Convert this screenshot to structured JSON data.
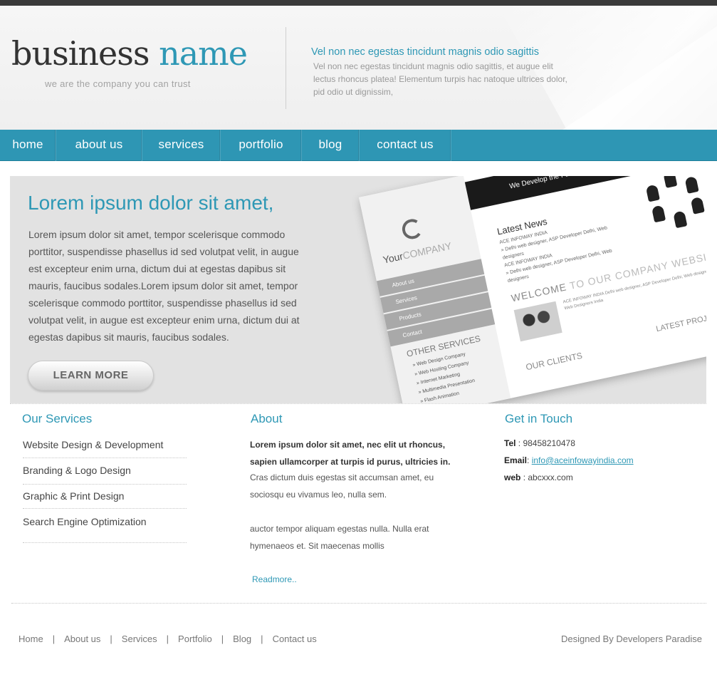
{
  "header": {
    "logo_word1": "business",
    "logo_word2": "name",
    "tagline": "we are the company you can trust",
    "intro_title": "Vel non nec egestas tincidunt magnis odio sagittis",
    "intro_text": "Vel non nec egestas tincidunt magnis odio sagittis, et augue elit lectus rhoncus platea! Elementum turpis hac natoque ultrices dolor, pid odio ut dignissim,"
  },
  "nav": {
    "items": [
      "home",
      "about us",
      "services",
      "portfolio",
      "blog",
      "contact us"
    ]
  },
  "hero": {
    "title": "Lorem ipsum dolor sit amet,",
    "text": "Lorem ipsum dolor sit amet, tempor scelerisque commodo porttitor, suspendisse phasellus id sed volutpat velit, in augue est excepteur enim urna, dictum dui at egestas dapibus sit mauris, faucibus sodales.Lorem ipsum dolor sit amet, tempor scelerisque commodo porttitor, suspendisse phasellus id sed volutpat velit, in augue est excepteur enim urna, dictum dui at egestas dapibus sit mauris, faucibus sodales.",
    "button_label": "LEARN MORE",
    "mockup": {
      "bar_text": "We Develop the Future ACE INFOWAY INDIA",
      "company_a": "Your",
      "company_b": "COMPANY",
      "menu": [
        "About us",
        "Services",
        "Products",
        "Contact"
      ],
      "other_services": "OTHER SERVICES",
      "other_list": [
        "» Web Design Company",
        "» Web Hosting Company",
        "» Internet Marketing",
        "» Multimedia Presentation",
        "» Flash Animation"
      ],
      "latest_news": "Latest News",
      "news_lines": [
        "ACE INFOWAY INDIA",
        "» Delhi web designer, ASP Developer Delhi, Web designers",
        "ACE INFOWAY INDIA",
        "» Delhi web designer, ASP Developer Delhi, Web designers"
      ],
      "welcome_a": "WELCOME",
      "welcome_b": "TO OUR COMPANY WEBSITE !",
      "welcome_text": "ACE INFOWAY INDIA Delhi web designer, ASP Developer Delhi, Web designers Delhi, Web Designers India",
      "our_clients": "OUR CLIENTS",
      "latest_projects": "LATEST PROJECTS"
    }
  },
  "services": {
    "title": "Our Services",
    "items": [
      "Website Design & Development",
      "Branding & Logo Design",
      "Graphic & Print Design",
      "Search Engine Optimization"
    ]
  },
  "about": {
    "title": "About",
    "bold_text": "Lorem ipsum dolor sit amet, nec elit ut rhoncus, sapien ullamcorper at turpis id purus, ultricies in.",
    "p1": "Cras dictum duis egestas sit accumsan amet, eu sociosqu eu vivamus leo, nulla sem.",
    "p2": "auctor tempor aliquam egestas nulla. Nulla erat hymenaeos et. Sit maecenas mollis",
    "readmore": "Readmore.."
  },
  "contact": {
    "title": "Get in Touch",
    "tel_label": "Tel",
    "tel_value": " : 98458210478",
    "email_label": "Email",
    "email_value": "info@aceinfowayindia.com",
    "web_label": "web",
    "web_value": ": abcxxx.com"
  },
  "footer": {
    "links": [
      "Home",
      "About us",
      "Services",
      "Portfolio",
      "Blog",
      "Contact us"
    ],
    "separator": "|",
    "credit": "Designed By Developers Paradise"
  },
  "colors": {
    "accent": "#2e98b5",
    "nav_bg": "#2e96b4",
    "topbar": "#3a3a3a"
  }
}
